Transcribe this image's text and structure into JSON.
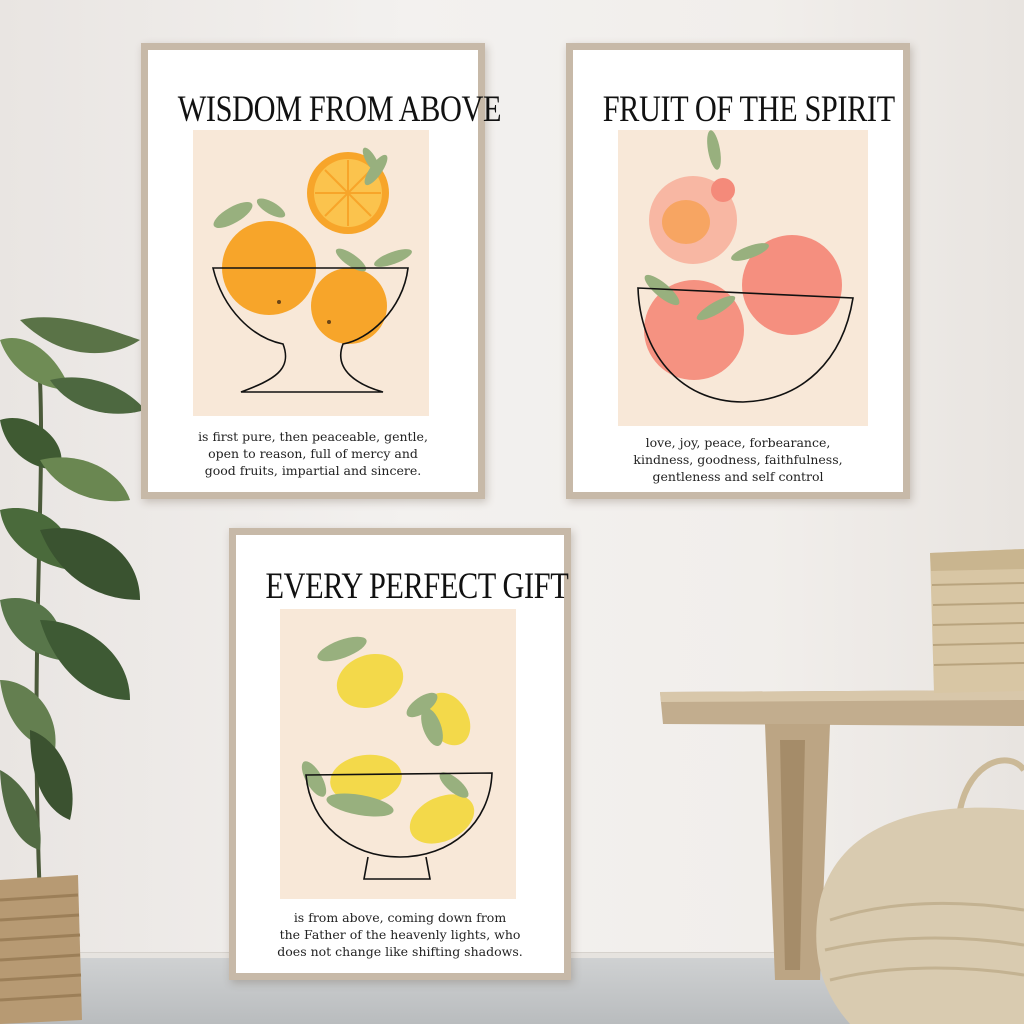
{
  "posters": [
    {
      "title": "WISDOM FROM ABOVE",
      "verse": [
        "is first pure, then peaceable, gentle,",
        "open to reason, full of mercy and",
        "good fruits, impartial and sincere."
      ],
      "fruit": "orange"
    },
    {
      "title": "FRUIT OF THE SPIRIT",
      "verse": [
        "love, joy, peace, forbearance,",
        "kindness, goodness, faithfulness,",
        "gentleness and self control"
      ],
      "fruit": "peach"
    },
    {
      "title": "EVERY PERFECT GIFT",
      "verse": [
        "is from above, coming down from",
        "the Father of the heavenly lights, who",
        "does not change like shifting shadows."
      ],
      "fruit": "lemon"
    }
  ],
  "colors": {
    "orange": "#f7a52a",
    "peach": "#f48a7a",
    "lemon": "#f3d94a",
    "leaf": "#98b07e",
    "art_background": "#f8e8d8",
    "frame": "#c7b9a8"
  }
}
